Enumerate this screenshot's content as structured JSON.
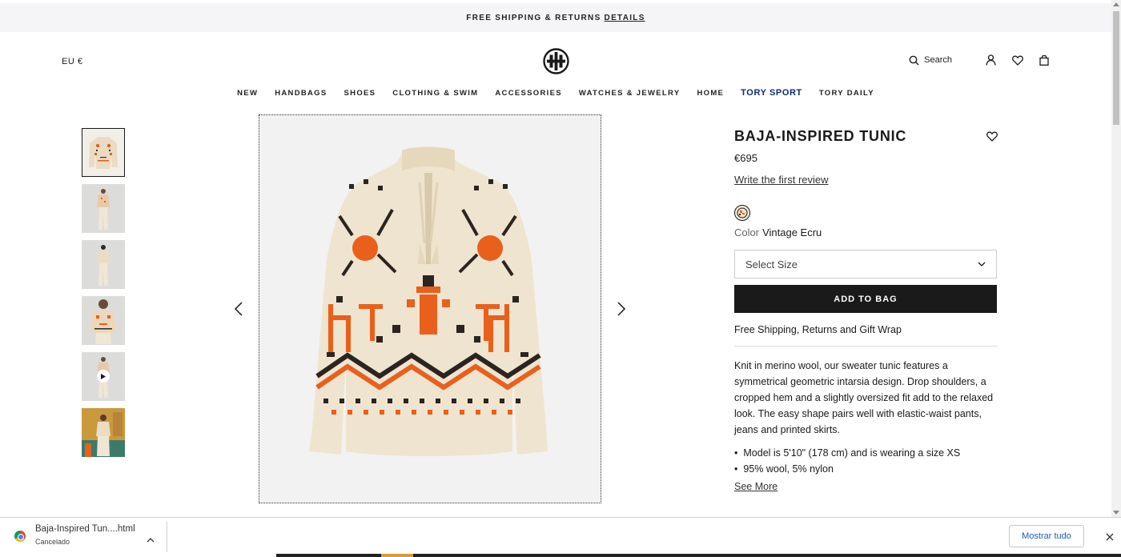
{
  "promo": {
    "text": "FREE SHIPPING & RETURNS",
    "link": "DETAILS"
  },
  "header": {
    "currency": "EU €",
    "search_label": "Search",
    "icons": [
      "search-icon",
      "account-icon",
      "wishlist-icon",
      "bag-icon"
    ]
  },
  "nav": [
    "NEW",
    "HANDBAGS",
    "SHOES",
    "CLOTHING & SWIM",
    "ACCESSORIES",
    "WATCHES & JEWELRY",
    "HOME",
    "TORY SPORT",
    "TORY DAILY"
  ],
  "gallery": {
    "thumbnails": [
      "product-flat",
      "model-front",
      "model-back",
      "model-closeup",
      "model-video",
      "lifestyle"
    ],
    "active_index": 0
  },
  "product": {
    "title": "BAJA-INSPIRED TUNIC",
    "price": "€695",
    "review_link": "Write the first review",
    "color_label": "Color",
    "color_value": "Vintage Ecru",
    "size_placeholder": "Select Size",
    "add_to_bag": "ADD TO BAG",
    "shipping": "Free Shipping, Returns and Gift Wrap",
    "description": "Knit in merino wool, our sweater tunic features a symmetrical geometric intarsia design. Drop shoulders, a cropped hem and a slightly oversized fit add to the relaxed look. The easy shape pairs well with elastic-waist pants, jeans and printed skirts.",
    "bullets": [
      "Model is 5'10\" (178 cm) and is wearing a size XS",
      "95% wool, 5% nylon"
    ],
    "see_more": "See More"
  },
  "download_bar": {
    "file_name": "Baja-Inspired Tun....html",
    "status": "Cancelado",
    "show_all": "Mostrar tudo"
  },
  "colors": {
    "accent_navy": "#0b2c6b",
    "orange": "#e8601c",
    "ecru": "#efe4cf",
    "black": "#1a1a1a"
  }
}
